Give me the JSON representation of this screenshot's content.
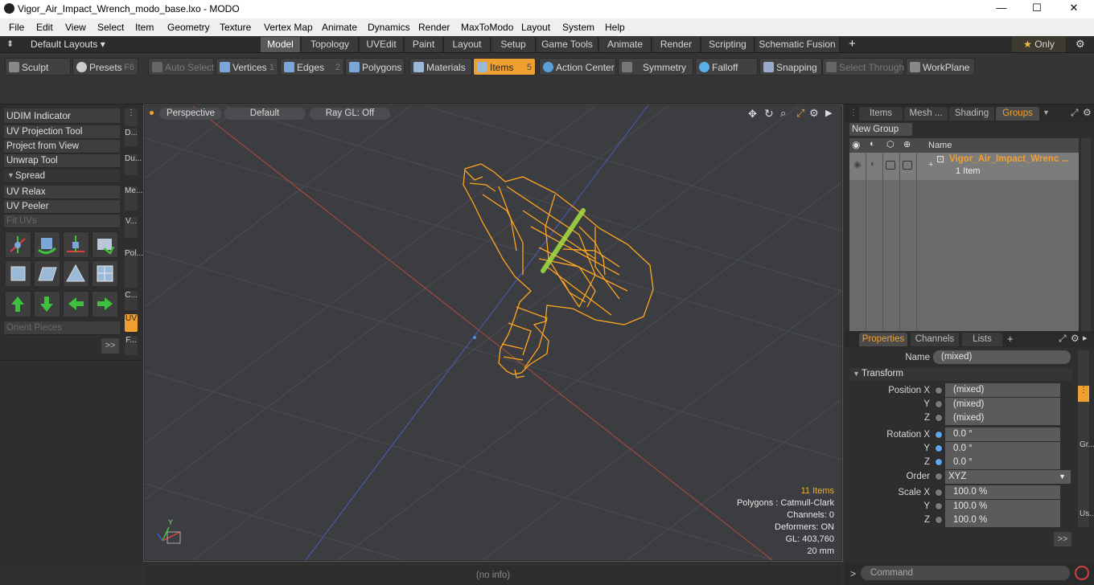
{
  "window": {
    "title": "Vigor_Air_Impact_Wrench_modo_base.lxo - MODO",
    "minimize": "—",
    "maximize": "☐",
    "close": "✕"
  },
  "menu": [
    "File",
    "Edit",
    "View",
    "Select",
    "Item",
    "Geometry",
    "Texture",
    "Vertex Map",
    "Animate",
    "Dynamics",
    "Render",
    "MaxToModo",
    "Layout",
    "System",
    "Help"
  ],
  "layouts": {
    "label": "Default Layouts ▾",
    "tabs": [
      "Model",
      "Topology",
      "UVEdit",
      "Paint",
      "Layout",
      "Setup",
      "Game Tools",
      "Animate",
      "Render",
      "Scripting",
      "Schematic Fusion"
    ],
    "active": "Model",
    "add": "+",
    "only": "Only"
  },
  "toolbar": {
    "sculpt": "Sculpt",
    "presets": "Presets",
    "presets_key": "F6",
    "auto_select": "Auto Select",
    "vertices": "Vertices",
    "vertices_key": "1",
    "edges": "Edges",
    "edges_key": "2",
    "polygons": "Polygons",
    "materials": "Materials",
    "items": "Items",
    "items_key": "5",
    "action_center": "Action Center",
    "symmetry": "Symmetry",
    "falloff": "Falloff",
    "snapping": "Snapping",
    "select_through": "Select Through",
    "workplane": "WorkPlane"
  },
  "left": {
    "udim": "UDIM Indicator",
    "items": [
      "UV Projection Tool",
      "Project from View",
      "Unwrap Tool"
    ],
    "spread": "Spread",
    "items2": [
      "UV Relax",
      "UV Peeler",
      "Fit UVs"
    ],
    "orient": "Orient Pieces",
    "more": ">>",
    "vtabs": [
      "D...",
      "Du...",
      "Me...",
      "V...",
      "Pol...",
      "C...",
      "UV",
      "F..."
    ]
  },
  "viewport": {
    "perspective": "Perspective",
    "default": "Default",
    "raygl": "Ray GL: Off",
    "stats": {
      "items": "11 Items",
      "polygons": "Polygons : Catmull-Clark",
      "channels": "Channels: 0",
      "deformers": "Deformers: ON",
      "gl": "GL: 403,760",
      "scale": "20 mm"
    },
    "axis_y": "Y",
    "axis_x": "X"
  },
  "status": "(no info)",
  "groups": {
    "tabs": [
      "Items",
      "Mesh ...",
      "Shading",
      "Groups"
    ],
    "new_group": "New Group",
    "name_header": "Name",
    "row_name": "Vigor_Air_Impact_Wrenc ...",
    "row_sub": "1 Item"
  },
  "properties": {
    "tabs": [
      "Properties",
      "Channels",
      "Lists"
    ],
    "name_label": "Name",
    "name_value": "(mixed)",
    "transform": "Transform",
    "pos": [
      {
        "l": "Position X",
        "v": "(mixed)"
      },
      {
        "l": "Y",
        "v": "(mixed)"
      },
      {
        "l": "Z",
        "v": "(mixed)"
      }
    ],
    "rot": [
      {
        "l": "Rotation X",
        "v": "0.0 °"
      },
      {
        "l": "Y",
        "v": "0.0 °"
      },
      {
        "l": "Z",
        "v": "0.0 °"
      }
    ],
    "order_label": "Order",
    "order_value": "XYZ",
    "scale": [
      {
        "l": "Scale X",
        "v": "100.0 %"
      },
      {
        "l": "Y",
        "v": "100.0 %"
      },
      {
        "l": "Z",
        "v": "100.0 %"
      }
    ],
    "more": ">>",
    "side": [
      "Gr...",
      "Us..."
    ]
  },
  "command": {
    "placeholder": "Command",
    "prompt": ">"
  },
  "colors": {
    "accent": "#f0a030",
    "mesh": "#ffa520",
    "stripe": "#a8e040"
  }
}
